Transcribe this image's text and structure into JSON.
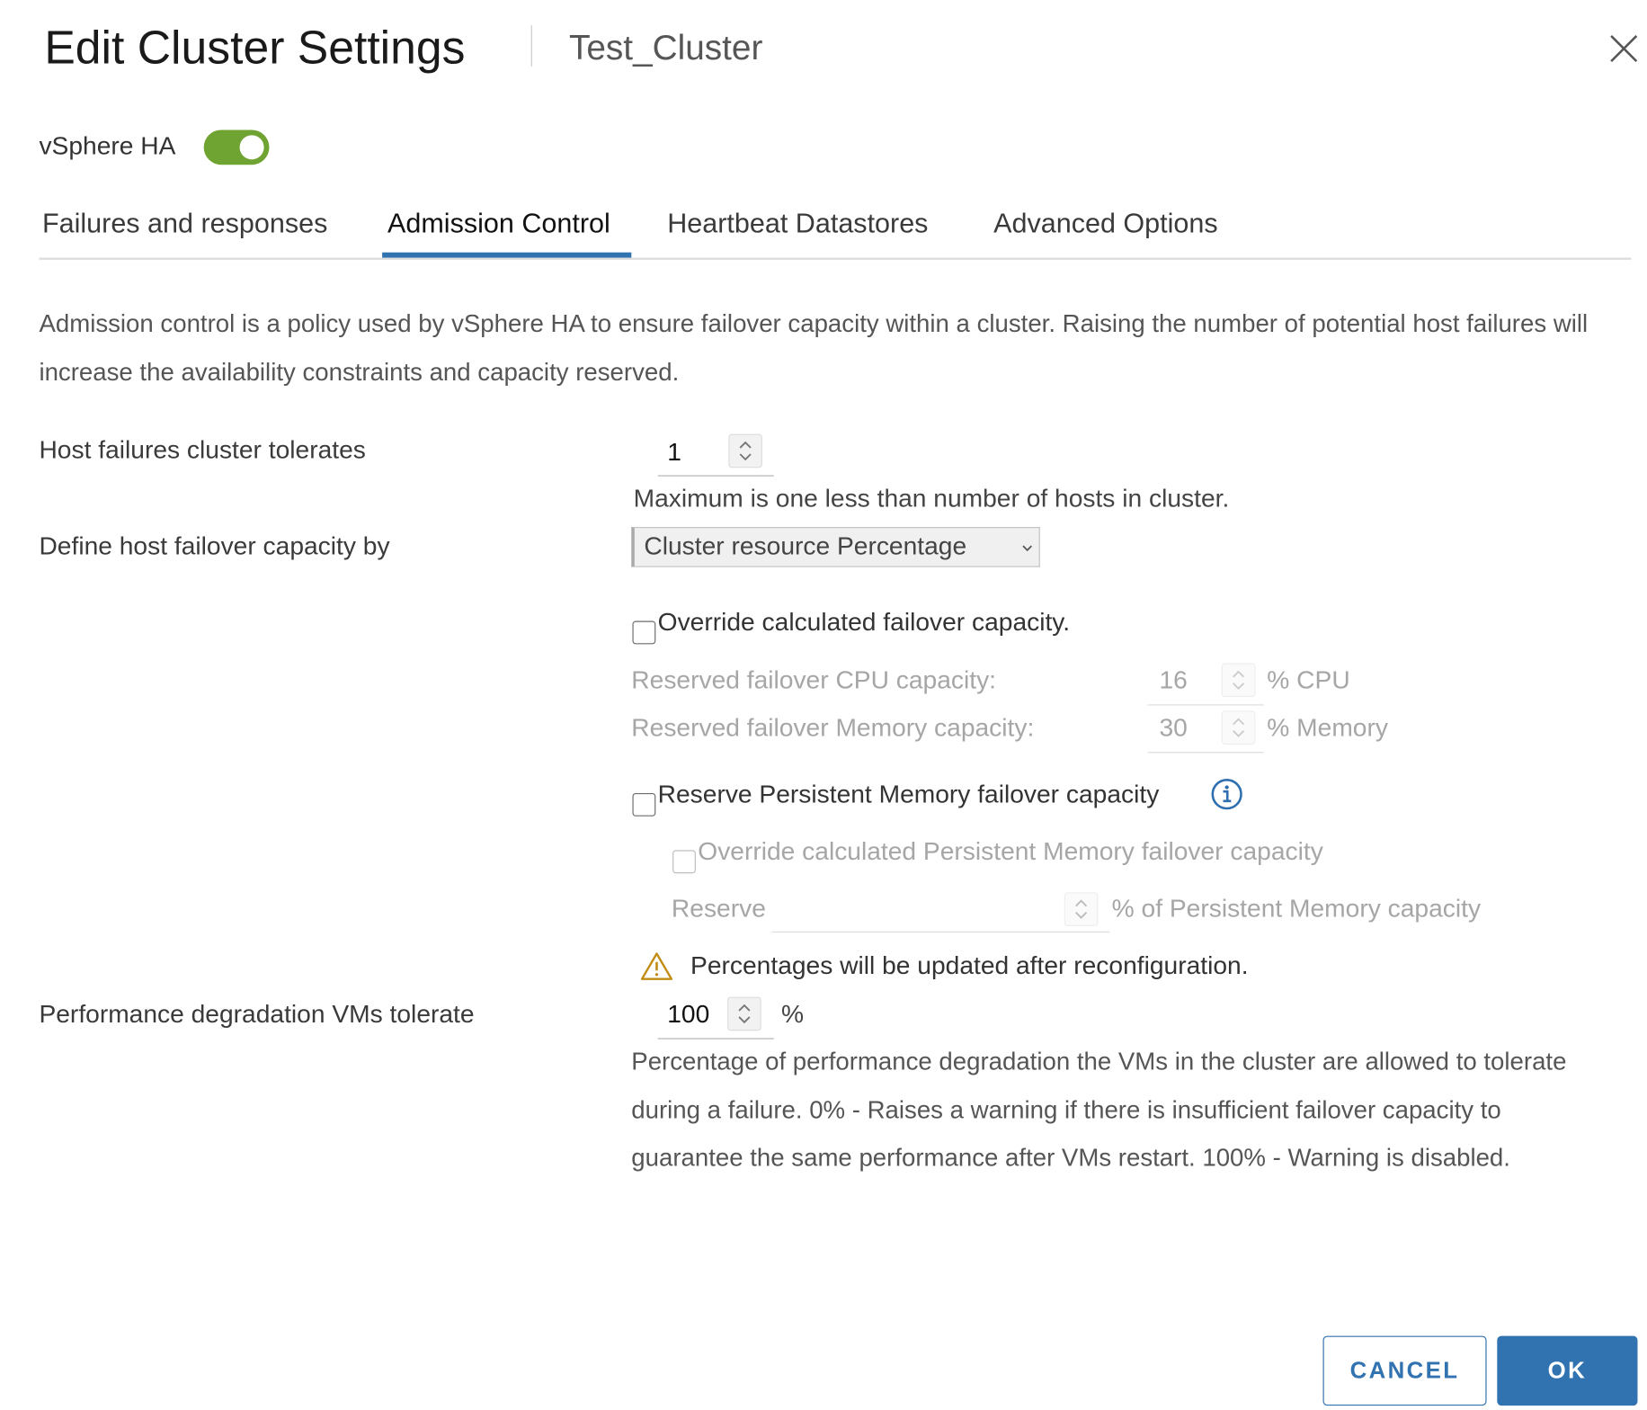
{
  "header": {
    "title": "Edit Cluster Settings",
    "subtitle": "Test_Cluster",
    "close_icon": "close-icon"
  },
  "ha": {
    "label": "vSphere HA",
    "enabled": true,
    "toggle_color": "#6fa332"
  },
  "tabs": [
    {
      "label": "Failures and responses",
      "active": false
    },
    {
      "label": "Admission Control",
      "active": true
    },
    {
      "label": "Heartbeat Datastores",
      "active": false
    },
    {
      "label": "Advanced Options",
      "active": false
    }
  ],
  "accent_color": "#3172b0",
  "description": "Admission control is a policy used by vSphere HA to ensure failover capacity within a cluster. Raising the number of potential host failures will increase the availability constraints and capacity reserved.",
  "host_failures": {
    "label": "Host failures cluster tolerates",
    "value": "1",
    "hint": "Maximum is one less than number of hosts in cluster."
  },
  "failover_by": {
    "label": "Define host failover capacity by",
    "selected": "Cluster resource Percentage"
  },
  "override": {
    "label": "Override calculated failover capacity.",
    "checked": false
  },
  "cpu": {
    "label": "Reserved failover CPU capacity:",
    "value": "16",
    "unit": "% CPU"
  },
  "memory": {
    "label": "Reserved failover Memory capacity:",
    "value": "30",
    "unit": "% Memory"
  },
  "pmem": {
    "label": "Reserve Persistent Memory failover capacity",
    "checked": false,
    "info_icon": "info-icon"
  },
  "pmem_override": {
    "label": "Override calculated Persistent Memory failover capacity",
    "checked": false
  },
  "pmem_reserve": {
    "label": "Reserve",
    "value": "",
    "unit": "% of Persistent Memory capacity"
  },
  "warning": {
    "icon": "warning-icon",
    "text": "Percentages will be updated after reconfiguration."
  },
  "perf": {
    "label": "Performance degradation VMs tolerate",
    "value": "100",
    "unit": "%",
    "description": "Percentage of performance degradation the VMs in the cluster are allowed to tolerate during a failure. 0% - Raises a warning if there is insufficient failover capacity to guarantee the same performance after VMs restart. 100% - Warning is disabled."
  },
  "footer": {
    "cancel": "CANCEL",
    "ok": "OK"
  }
}
